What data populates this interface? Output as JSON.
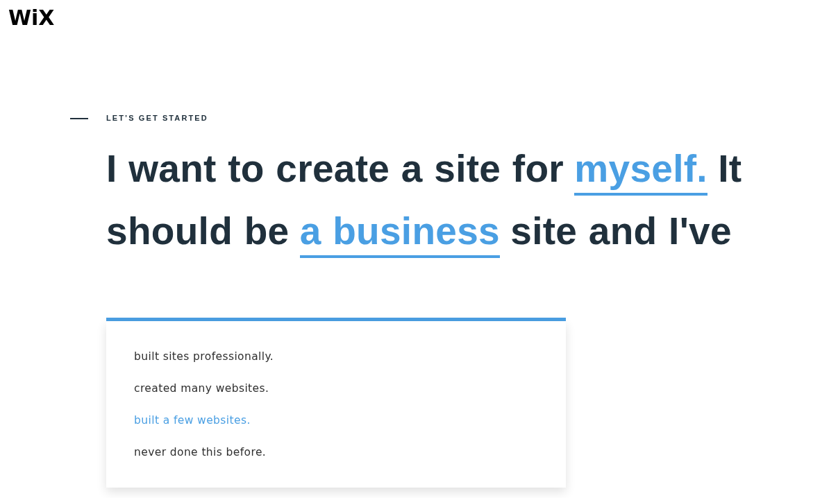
{
  "logo": {
    "text": "WiX"
  },
  "eyebrow": "LET’S GET STARTED",
  "sentence": {
    "lines": [
      {
        "parts": [
          {
            "kind": "text",
            "text": "I want to create a site for"
          },
          {
            "kind": "choice",
            "text": "myself."
          },
          {
            "kind": "text",
            "text": "It"
          }
        ]
      },
      {
        "parts": [
          {
            "kind": "text",
            "text": "should be"
          },
          {
            "kind": "choice",
            "text": "a business"
          },
          {
            "kind": "text",
            "text": "site and I've"
          }
        ]
      },
      {
        "parts": [
          {
            "kind": "dropdown",
            "expanded": true,
            "options": [
              {
                "text": "built sites professionally.",
                "selected": false
              },
              {
                "text": "created many websites.",
                "selected": false
              },
              {
                "text": "built a few websites.",
                "selected": true
              },
              {
                "text": "never done this before.",
                "selected": false
              }
            ]
          }
        ]
      }
    ]
  }
}
